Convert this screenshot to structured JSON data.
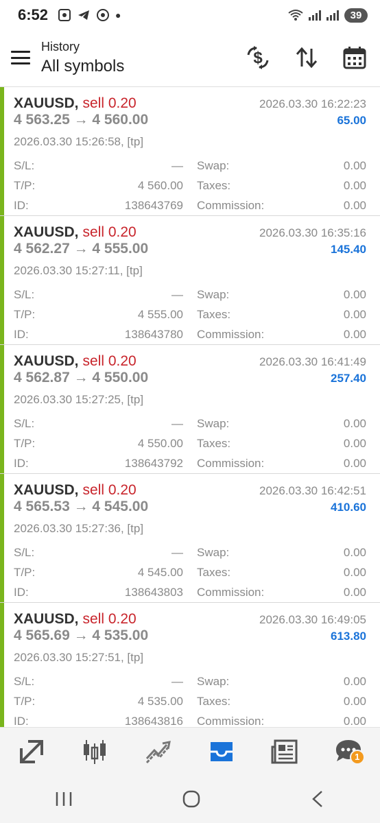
{
  "status_bar": {
    "time": "6:52",
    "battery": "39"
  },
  "header": {
    "subtitle": "History",
    "title": "All symbols"
  },
  "deals": [
    {
      "symbol": "XAUUSD,",
      "side": "sell 0.20",
      "close_time": "2026.03.30 16:22:23",
      "prices": "4 563.25 → 4 560.00",
      "profit": "65.00",
      "open_time": "2026.03.30 15:26:58, [tp]",
      "sl": "—",
      "tp": "4 560.00",
      "id": "138643769",
      "swap": "0.00",
      "taxes": "0.00",
      "commission": "0.00"
    },
    {
      "symbol": "XAUUSD,",
      "side": "sell 0.20",
      "close_time": "2026.03.30 16:35:16",
      "prices": "4 562.27 → 4 555.00",
      "profit": "145.40",
      "open_time": "2026.03.30 15:27:11, [tp]",
      "sl": "—",
      "tp": "4 555.00",
      "id": "138643780",
      "swap": "0.00",
      "taxes": "0.00",
      "commission": "0.00"
    },
    {
      "symbol": "XAUUSD,",
      "side": "sell 0.20",
      "close_time": "2026.03.30 16:41:49",
      "prices": "4 562.87 → 4 550.00",
      "profit": "257.40",
      "open_time": "2026.03.30 15:27:25, [tp]",
      "sl": "—",
      "tp": "4 550.00",
      "id": "138643792",
      "swap": "0.00",
      "taxes": "0.00",
      "commission": "0.00"
    },
    {
      "symbol": "XAUUSD,",
      "side": "sell 0.20",
      "close_time": "2026.03.30 16:42:51",
      "prices": "4 565.53 → 4 545.00",
      "profit": "410.60",
      "open_time": "2026.03.30 15:27:36, [tp]",
      "sl": "—",
      "tp": "4 545.00",
      "id": "138643803",
      "swap": "0.00",
      "taxes": "0.00",
      "commission": "0.00"
    },
    {
      "symbol": "XAUUSD,",
      "side": "sell 0.20",
      "close_time": "2026.03.30 16:49:05",
      "prices": "4 565.69 → 4 535.00",
      "profit": "613.80",
      "open_time": "2026.03.30 15:27:51, [tp]",
      "sl": "—",
      "tp": "4 535.00",
      "id": "138643816",
      "swap": "0.00",
      "taxes": "0.00",
      "commission": "0.00"
    }
  ],
  "labels": {
    "sl": "S/L:",
    "tp": "T/P:",
    "id": "ID:",
    "swap": "Swap:",
    "taxes": "Taxes:",
    "commission": "Commission:"
  },
  "bottom_nav": {
    "items": [
      "quotes-icon",
      "chart-icon",
      "trade-icon",
      "history-icon",
      "news-icon",
      "chat-icon"
    ],
    "active": "history-icon",
    "chat_badge": "1"
  },
  "colors": {
    "accent": "#1a73d9",
    "sell": "#c8242b",
    "profit_bar": "#7ab51d"
  }
}
